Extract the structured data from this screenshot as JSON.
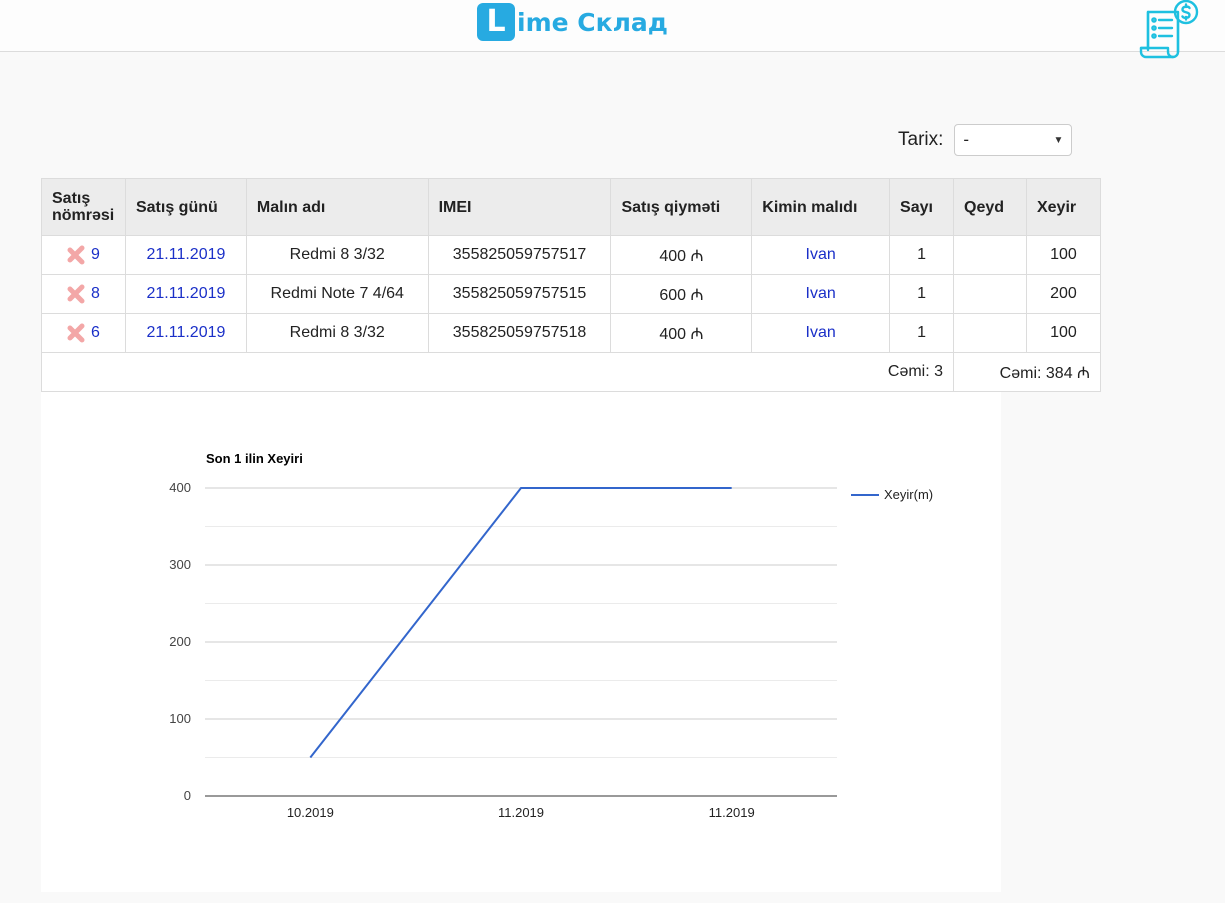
{
  "header": {
    "logo_letter": "L",
    "logo_text": "ime Склад",
    "receipt_icon": "receipt-dollar-icon",
    "accent_color": "#27aae1"
  },
  "filter": {
    "label": "Tarix:",
    "selected": "-"
  },
  "table": {
    "headers": [
      "Satış nömrəsi",
      "Satış günü",
      "Malın adı",
      "IMEI",
      "Satış qiyməti",
      "Kimin malıdı",
      "Sayı",
      "Qeyd",
      "Xeyir"
    ],
    "rows": [
      {
        "no": "9",
        "date": "21.11.2019",
        "name": "Redmi 8 3/32",
        "imei": "355825059757517",
        "price": "400 ₼",
        "owner": "Ivan",
        "count": "1",
        "note": "",
        "profit": "100"
      },
      {
        "no": "8",
        "date": "21.11.2019",
        "name": "Redmi Note 7 4/64",
        "imei": "355825059757515",
        "price": "600 ₼",
        "owner": "Ivan",
        "count": "1",
        "note": "",
        "profit": "200"
      },
      {
        "no": "6",
        "date": "21.11.2019",
        "name": "Redmi 8 3/32",
        "imei": "355825059757518",
        "price": "400 ₼",
        "owner": "Ivan",
        "count": "1",
        "note": "",
        "profit": "100"
      }
    ],
    "total_count": "Cəmi: 3",
    "total_profit": "Cəmi: 384 ₼"
  },
  "chart_data": {
    "type": "line",
    "title": "Son 1 ilin Xeyiri",
    "x": [
      "10.2019",
      "11.2019",
      "11.2019"
    ],
    "series": [
      {
        "name": "Xeyir(m)",
        "values": [
          50,
          400,
          400
        ],
        "color": "#3366cc"
      }
    ],
    "ylim": [
      0,
      400
    ],
    "yticks": [
      0,
      100,
      200,
      300,
      400
    ],
    "grid": true,
    "legend": "right"
  }
}
